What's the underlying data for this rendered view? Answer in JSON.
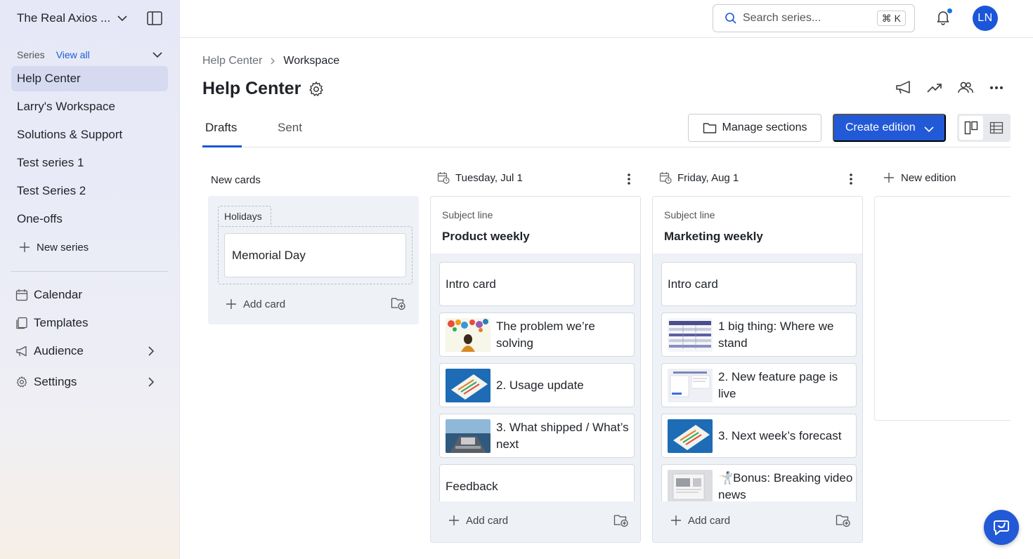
{
  "sidebar": {
    "workspace_name": "The Real Axios ...",
    "series_label": "Series",
    "view_all": "View all",
    "series": [
      {
        "label": "Help Center",
        "active": true
      },
      {
        "label": "Larry's Workspace"
      },
      {
        "label": "Solutions & Support"
      },
      {
        "label": "Test series 1"
      },
      {
        "label": "Test Series 2"
      },
      {
        "label": "One-offs"
      }
    ],
    "new_series": "New series",
    "nav": [
      {
        "label": "Calendar",
        "icon": "calendar-icon"
      },
      {
        "label": "Templates",
        "icon": "templates-icon"
      },
      {
        "label": "Audience",
        "icon": "megaphone-icon"
      },
      {
        "label": "Settings",
        "icon": "gear-icon"
      }
    ]
  },
  "topbar": {
    "search_placeholder": "Search series...",
    "shortcut": "⌘ K",
    "avatar_initials": "LN"
  },
  "header": {
    "breadcrumb": [
      "Help Center",
      "Workspace"
    ],
    "title": "Help Center",
    "tabs": [
      "Drafts",
      "Sent"
    ],
    "manage_sections": "Manage sections",
    "create_edition": "Create edition"
  },
  "board": {
    "new_cards": {
      "label": "New cards",
      "section": "Holidays",
      "cards": [
        "Memorial Day"
      ],
      "add_card": "Add card"
    },
    "editions": [
      {
        "date": "Tuesday, Jul 1",
        "subject_label": "Subject line",
        "subject": "Product weekly",
        "cards": [
          {
            "text": "Intro card"
          },
          {
            "text": "The problem we’re solving"
          },
          {
            "text": "2. Usage update"
          },
          {
            "text": "3. What shipped / What’s next"
          },
          {
            "text": "Feedback"
          }
        ],
        "add_card": "Add card"
      },
      {
        "date": "Friday, Aug 1",
        "subject_label": "Subject line",
        "subject": "Marketing weekly",
        "cards": [
          {
            "text": "Intro card"
          },
          {
            "text": "1 big thing: Where we stand"
          },
          {
            "text": "2. New feature page is live"
          },
          {
            "text": "3. Next week’s forecast"
          },
          {
            "text": "🤺Bonus: Breaking video news"
          }
        ],
        "add_card": "Add card"
      }
    ],
    "new_edition": "New edition"
  },
  "colors": {
    "accent": "#2259d6",
    "active_nav": "#d5daf0",
    "column_bg": "#eef1f6"
  }
}
